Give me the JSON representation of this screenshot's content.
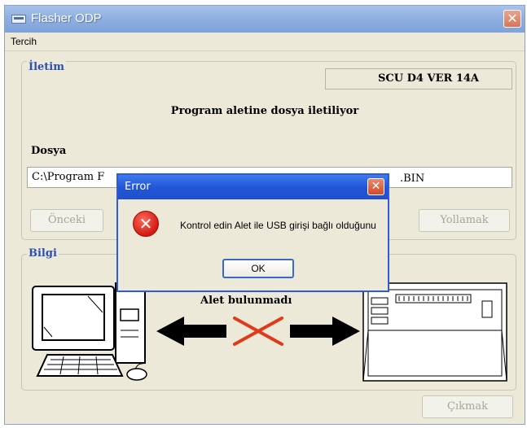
{
  "window": {
    "title": "Flasher ODP",
    "close_glyph": "✕"
  },
  "menu": {
    "items": [
      {
        "label": "Tercih"
      }
    ]
  },
  "iletim": {
    "label": "İletim",
    "version": "SCU D4 VER  14A",
    "status": "Program aletine dosya iletiliyor",
    "file_label": "Dosya",
    "file_value": "C:\\Program F",
    "file_suffix": ".BIN",
    "prev_button": "Önceki",
    "send_button": "Yollamak"
  },
  "bilgi": {
    "label": "Bilgi",
    "alert": "Alet bulunmadı"
  },
  "exit_button": "Çıkmak",
  "dialog": {
    "title": "Error",
    "close_glyph": "✕",
    "icon_glyph": "✕",
    "message": "Kontrol edin Alet ile USB girişi bağlı olduğunu",
    "ok_button": "OK"
  },
  "icons": {
    "app": "window-app-icon",
    "error": "error-icon",
    "computer": "computer-illustration",
    "device": "device-illustration"
  },
  "colors": {
    "title_gradient": "#8fb0e0",
    "group_label": "#2b4fb5",
    "dialog_title": "#2256d6",
    "error_red": "#d11b12",
    "arrow": "#000000",
    "cross": "#e03a1a"
  }
}
